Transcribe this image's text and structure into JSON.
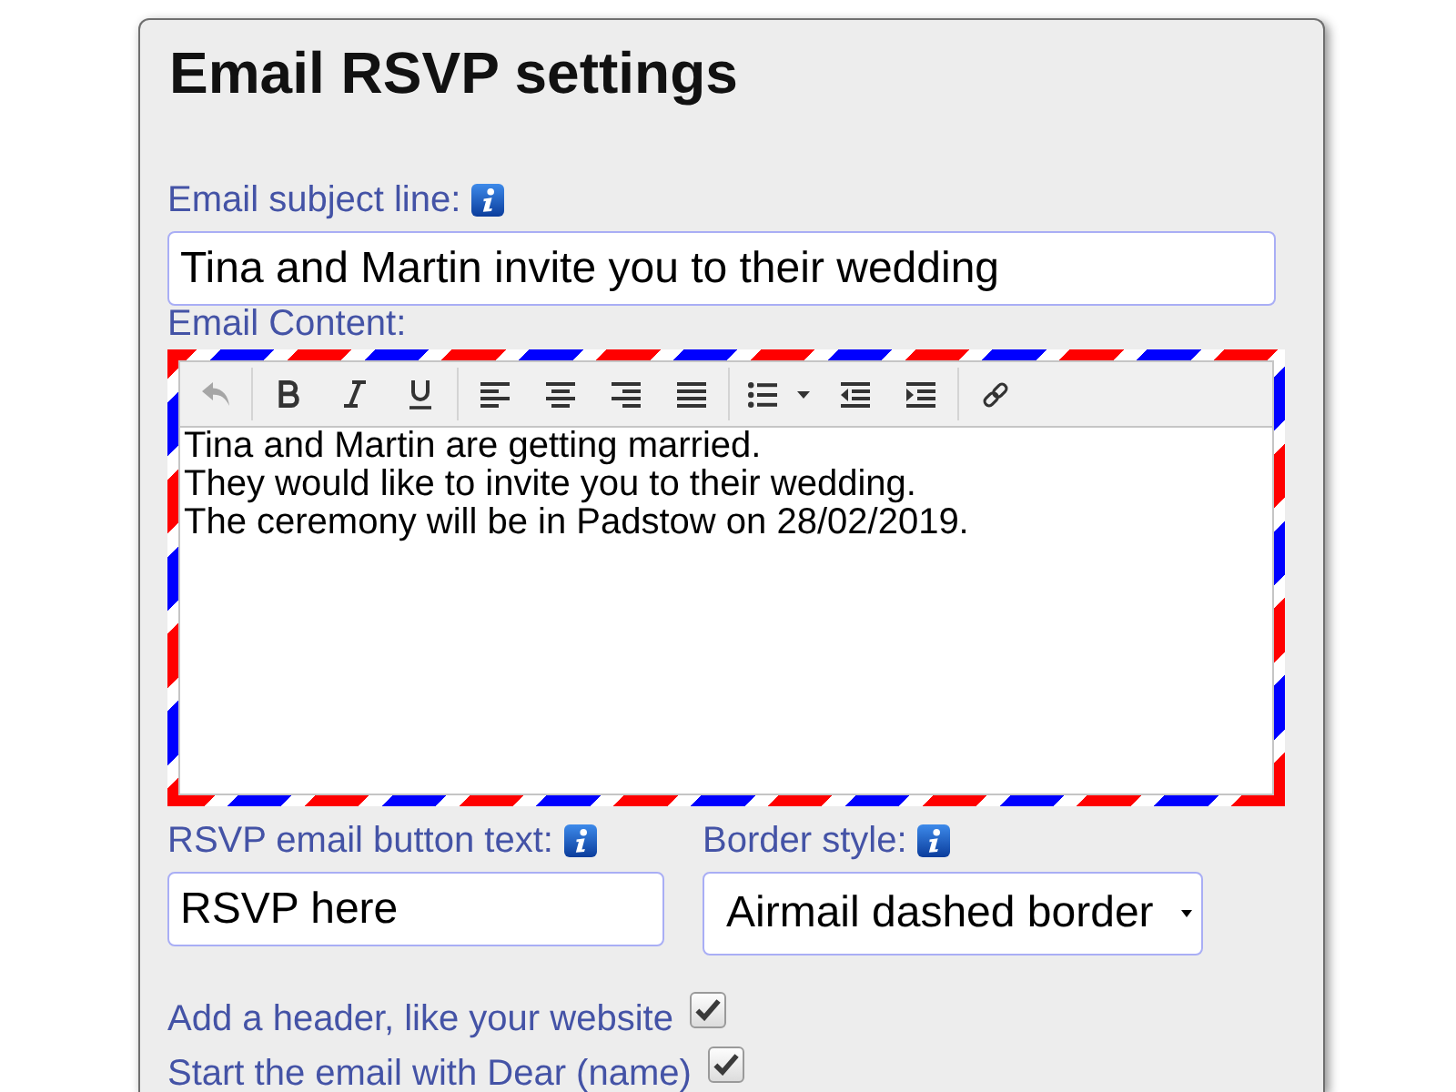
{
  "title": "Email RSVP settings",
  "subject": {
    "label": "Email subject line:",
    "info_icon": true,
    "value": "Tina and Martin invite you to their wedding"
  },
  "content": {
    "label": "Email Content:",
    "toolbar": [
      [
        {
          "kind": "undo",
          "disabled": true
        }
      ],
      [
        {
          "kind": "bold",
          "disabled": false
        },
        {
          "kind": "italic",
          "disabled": false
        },
        {
          "kind": "underline",
          "disabled": false
        }
      ],
      [
        {
          "kind": "align_left",
          "disabled": false
        },
        {
          "kind": "align_center",
          "disabled": false
        },
        {
          "kind": "align_right",
          "disabled": false
        },
        {
          "kind": "justify",
          "disabled": false
        }
      ],
      [
        {
          "kind": "bullet_list",
          "disabled": false
        },
        {
          "kind": "outdent",
          "disabled": false
        },
        {
          "kind": "indent",
          "disabled": false
        }
      ],
      [
        {
          "kind": "link",
          "disabled": false
        }
      ]
    ],
    "lines": [
      "Tina and Martin are getting married.",
      "They would like to invite you to their wedding.",
      "The ceremony will be in Padstow on 28/02/2019."
    ]
  },
  "button_text": {
    "label": "RSVP email button text:",
    "info_icon": true,
    "value": "RSVP here"
  },
  "border_style": {
    "label": "Border style:",
    "info_icon": true,
    "value": "Airmail dashed border"
  },
  "options": [
    {
      "label": "Add a header, like your website",
      "checked": true
    },
    {
      "label": "Start the email with Dear (name)",
      "checked": true
    }
  ]
}
